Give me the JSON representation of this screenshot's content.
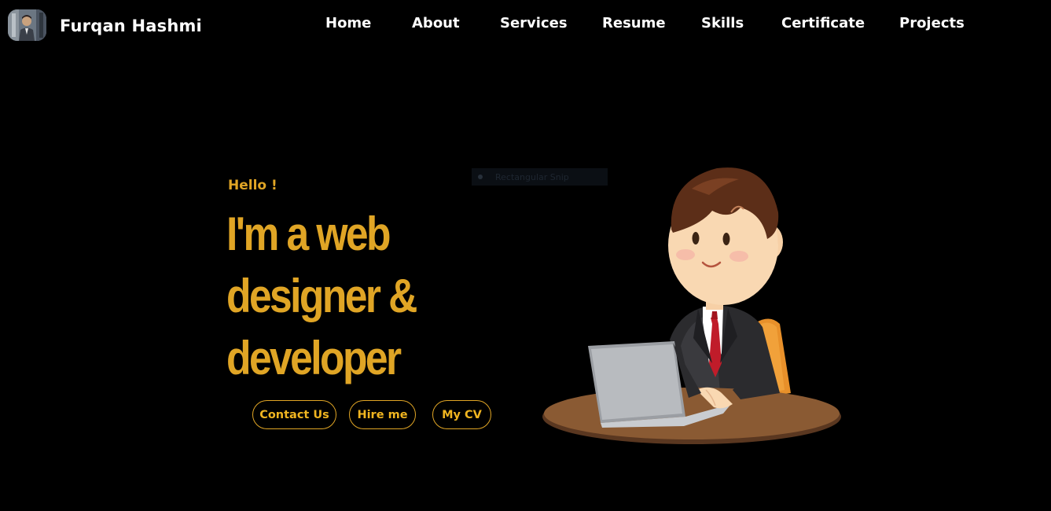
{
  "header": {
    "brand_name": "Furqan Hashmi",
    "avatar_icon": "profile-photo"
  },
  "nav": {
    "items": [
      {
        "label": "Home"
      },
      {
        "label": "About"
      },
      {
        "label": "Services"
      },
      {
        "label": "Resume"
      },
      {
        "label": "Skills"
      },
      {
        "label": "Certificate"
      },
      {
        "label": "Projects"
      }
    ]
  },
  "hero": {
    "greeting": "Hello !",
    "headline_lines": [
      "I'm a web",
      "designer &",
      "developer"
    ],
    "buttons": {
      "contact": "Contact Us",
      "hire": "Hire me",
      "cv": "My CV"
    },
    "illustration_icon": "developer-at-laptop-illustration"
  },
  "overlay": {
    "snip_label": "Rectangular Snip"
  },
  "colors": {
    "background": "#000000",
    "accent": "#e0a525",
    "nav_text": "#ffffff"
  }
}
